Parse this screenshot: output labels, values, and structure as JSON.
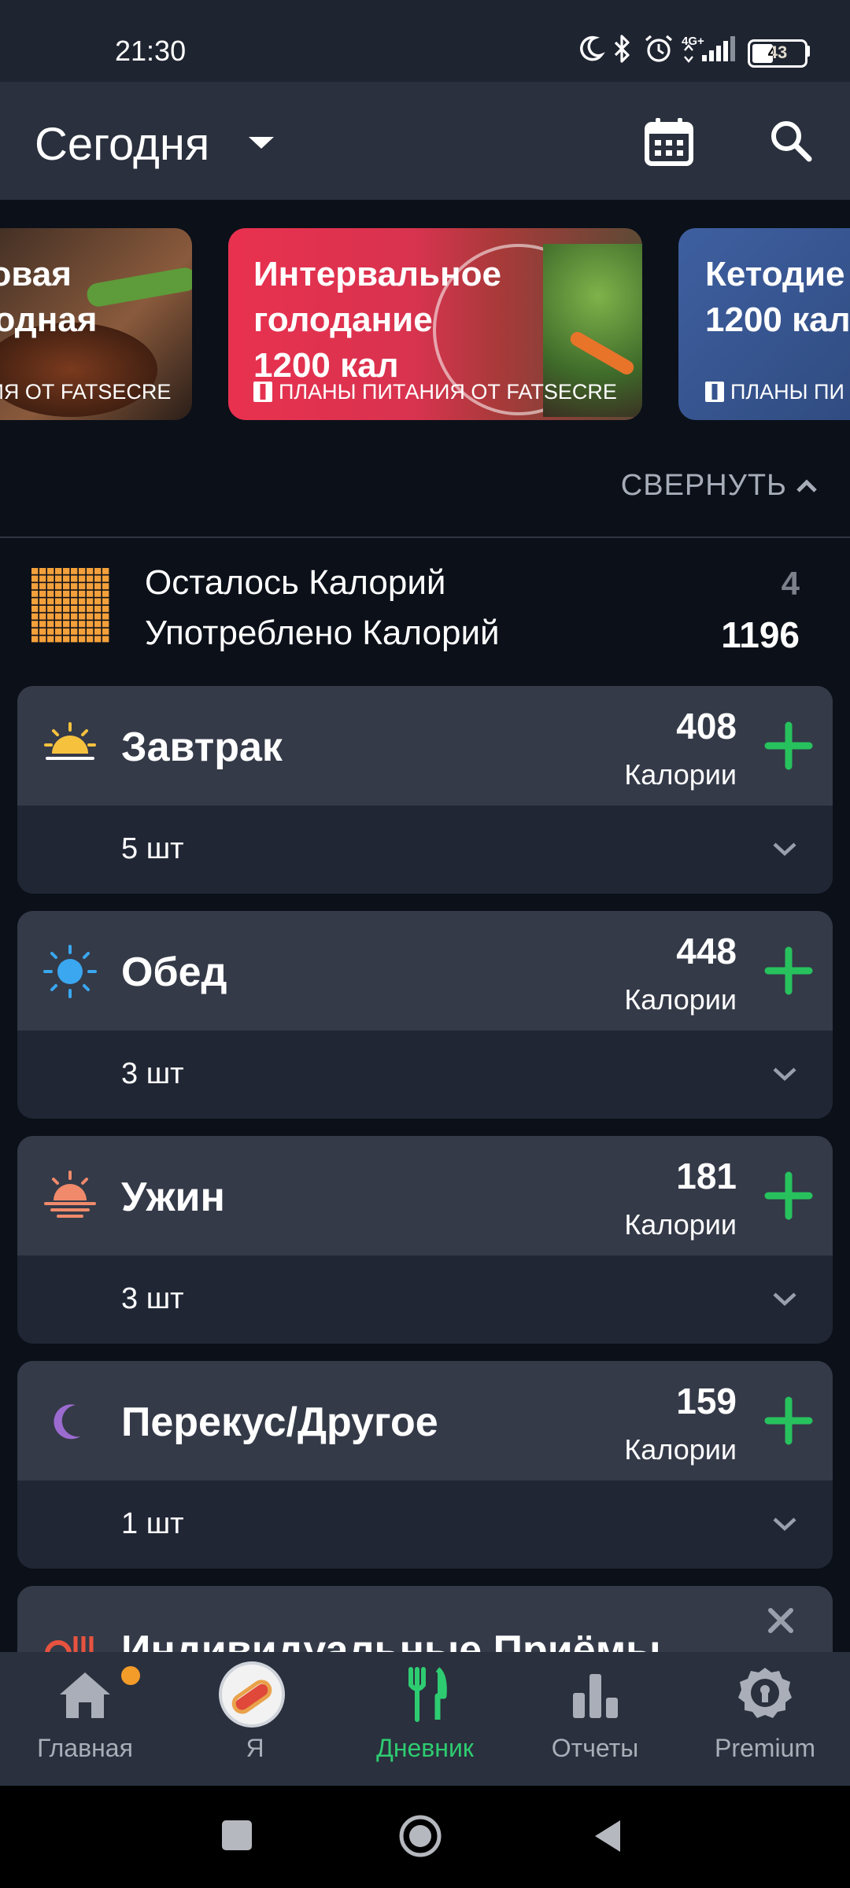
{
  "status_bar": {
    "time": "21:30",
    "battery": "43",
    "network": "4G+"
  },
  "header": {
    "date_label": "Сегодня"
  },
  "banners": [
    {
      "title_line1": "ковая",
      "title_line2": "водная",
      "subtitle": "НИЯ ОТ FATSECRE",
      "color": "#6b4a3a"
    },
    {
      "title_line1": "Интервальное",
      "title_line2": "голодание",
      "title_line3": "1200 кал",
      "subtitle": "ПЛАНЫ ПИТАНИЯ ОТ FATSECRE",
      "color": "#d8334f"
    },
    {
      "title_line1": "Кетодие",
      "title_line2": "1200 кал",
      "subtitle": "ПЛАНЫ ПИ",
      "color": "#3b5a92"
    }
  ],
  "collapse_label": "СВЕРНУТЬ",
  "summary": {
    "remaining_label": "Осталось Калорий",
    "remaining_value": "4",
    "consumed_label": "Употреблено Калорий",
    "consumed_value": "1196"
  },
  "meals": [
    {
      "name": "Завтрак",
      "calories": "408",
      "calories_label": "Калории",
      "count": "5 шт",
      "icon": "sunrise-icon",
      "icon_color": "#f6c23e"
    },
    {
      "name": "Обед",
      "calories": "448",
      "calories_label": "Калории",
      "count": "3 шт",
      "icon": "sun-icon",
      "icon_color": "#3aa7f0"
    },
    {
      "name": "Ужин",
      "calories": "181",
      "calories_label": "Калории",
      "count": "3 шт",
      "icon": "sunset-icon",
      "icon_color": "#f08a6b"
    },
    {
      "name": "Перекус/Другое",
      "calories": "159",
      "calories_label": "Калории",
      "count": "1 шт",
      "icon": "moon-icon",
      "icon_color": "#9b6bd0"
    }
  ],
  "partial_card": {
    "title": "Индивидуальные Приёмы"
  },
  "nav": [
    {
      "label": "Главная",
      "icon": "home-icon"
    },
    {
      "label": "Я",
      "icon": "avatar-icon"
    },
    {
      "label": "Дневник",
      "icon": "fork-knife-icon"
    },
    {
      "label": "Отчеты",
      "icon": "bar-chart-icon"
    },
    {
      "label": "Premium",
      "icon": "premium-badge-icon"
    }
  ],
  "colors": {
    "accent": "#2ecc71",
    "add": "#27c25e",
    "notification": "#f39c2a",
    "grid": "#f4a03b"
  }
}
